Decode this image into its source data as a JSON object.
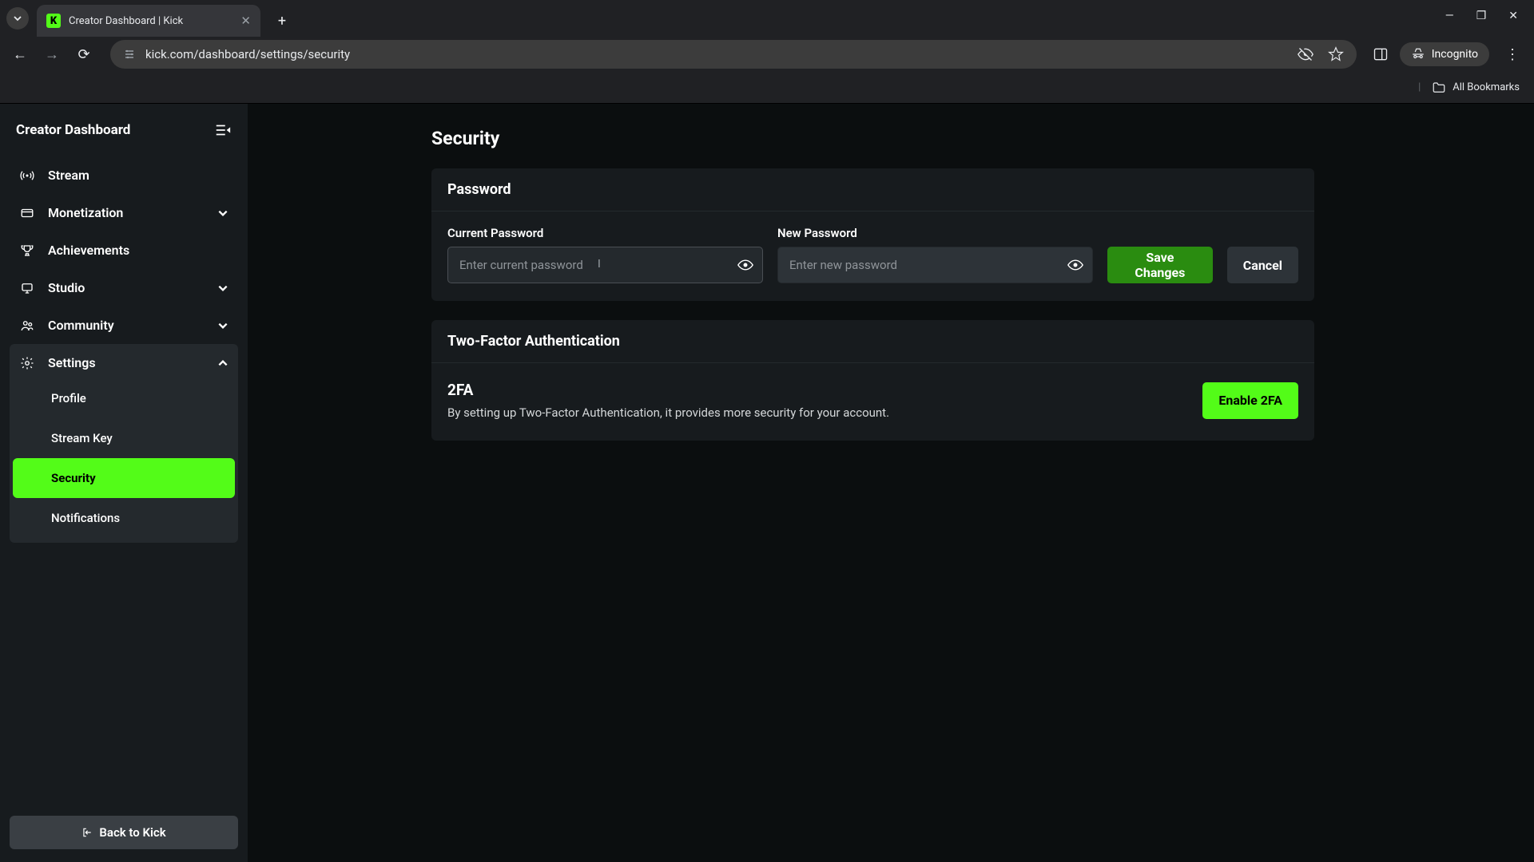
{
  "browser": {
    "tab_title": "Creator Dashboard | Kick",
    "url": "kick.com/dashboard/settings/security",
    "incognito_label": "Incognito",
    "all_bookmarks": "All Bookmarks"
  },
  "sidebar": {
    "title": "Creator Dashboard",
    "items": [
      {
        "label": "Stream"
      },
      {
        "label": "Monetization"
      },
      {
        "label": "Achievements"
      },
      {
        "label": "Studio"
      },
      {
        "label": "Community"
      },
      {
        "label": "Settings"
      }
    ],
    "settings_children": [
      {
        "label": "Profile"
      },
      {
        "label": "Stream Key"
      },
      {
        "label": "Security"
      },
      {
        "label": "Notifications"
      }
    ],
    "back_label": "Back to Kick"
  },
  "page": {
    "title": "Security",
    "password_section": {
      "header": "Password",
      "current_label": "Current Password",
      "current_placeholder": "Enter current password",
      "new_label": "New Password",
      "new_placeholder": "Enter new password",
      "save_label": "Save Changes",
      "cancel_label": "Cancel"
    },
    "tfa_section": {
      "header": "Two-Factor Authentication",
      "title": "2FA",
      "desc": "By setting up Two-Factor Authentication, it provides more security for your account.",
      "enable_label": "Enable 2FA"
    }
  }
}
